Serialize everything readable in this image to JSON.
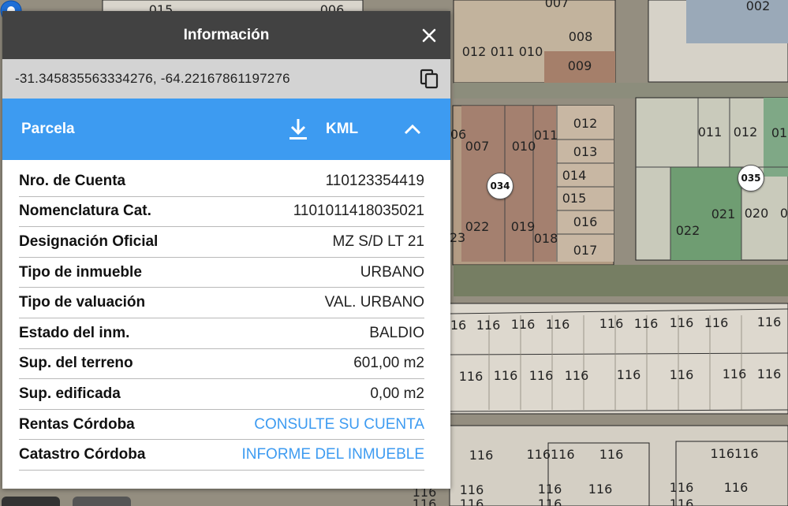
{
  "panel": {
    "title": "Información",
    "coords": "-31.345835563334276, -64.22167861197276",
    "section": {
      "title": "Parcela",
      "kml_label": "KML"
    },
    "rows": [
      {
        "label": "Nro. de Cuenta",
        "value": "110123354419",
        "link": false
      },
      {
        "label": "Nomenclatura Cat.",
        "value": "1101011418035021",
        "link": false
      },
      {
        "label": "Designación Oficial",
        "value": "MZ S/D LT 21",
        "link": false
      },
      {
        "label": "Tipo de inmueble",
        "value": "URBANO",
        "link": false
      },
      {
        "label": "Tipo de valuación",
        "value": "VAL. URBANO",
        "link": false
      },
      {
        "label": "Estado del inm.",
        "value": "BALDIO",
        "link": false
      },
      {
        "label": "Sup. del terreno",
        "value": "601,00 m2",
        "link": false
      },
      {
        "label": "Sup. edificada",
        "value": "0,00 m2",
        "link": false
      },
      {
        "label": "Rentas Córdoba",
        "value": "CONSULTE SU CUENTA",
        "link": true
      },
      {
        "label": "Catastro Córdoba",
        "value": "INFORME DEL INMUEBLE",
        "link": true
      }
    ]
  },
  "map": {
    "badges": [
      "034",
      "035"
    ],
    "labels": [
      "015",
      "006",
      "007",
      "002",
      "008",
      "012",
      "011",
      "010",
      "009",
      "06",
      "007",
      "010",
      "011",
      "012",
      "013",
      "014",
      "015",
      "016",
      "017",
      "022",
      "019",
      "018",
      "23",
      "011",
      "012",
      "01",
      "021",
      "020",
      "0",
      "022",
      "16",
      "116",
      "116",
      "116",
      "116",
      "116",
      "116",
      "116",
      "116",
      "116",
      "116",
      "116",
      "116",
      "116",
      "116",
      "116",
      "116",
      "116",
      "116116",
      "116",
      "116116",
      "116",
      "116",
      "116",
      "116",
      "116",
      "116",
      "116",
      "116",
      "116",
      "116"
    ]
  }
}
